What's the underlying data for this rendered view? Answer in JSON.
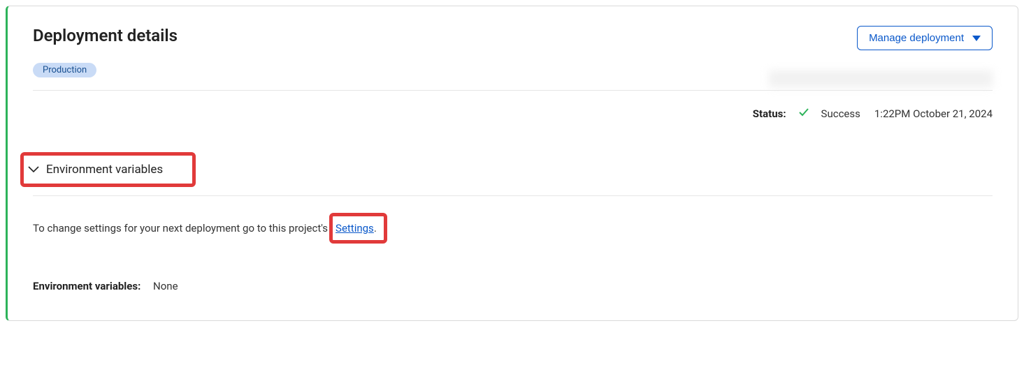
{
  "header": {
    "title": "Deployment details",
    "manage_button_label": "Manage deployment"
  },
  "badge": {
    "label": "Production"
  },
  "status": {
    "label": "Status:",
    "value": "Success",
    "timestamp": "1:22PM October 21, 2024"
  },
  "section": {
    "env_vars_title": "Environment variables"
  },
  "help": {
    "text_prefix": "To change settings for your next deployment go to this project's ",
    "settings_link_label": "Settings",
    "text_suffix": "."
  },
  "envvars": {
    "label": "Environment variables:",
    "value": "None"
  }
}
